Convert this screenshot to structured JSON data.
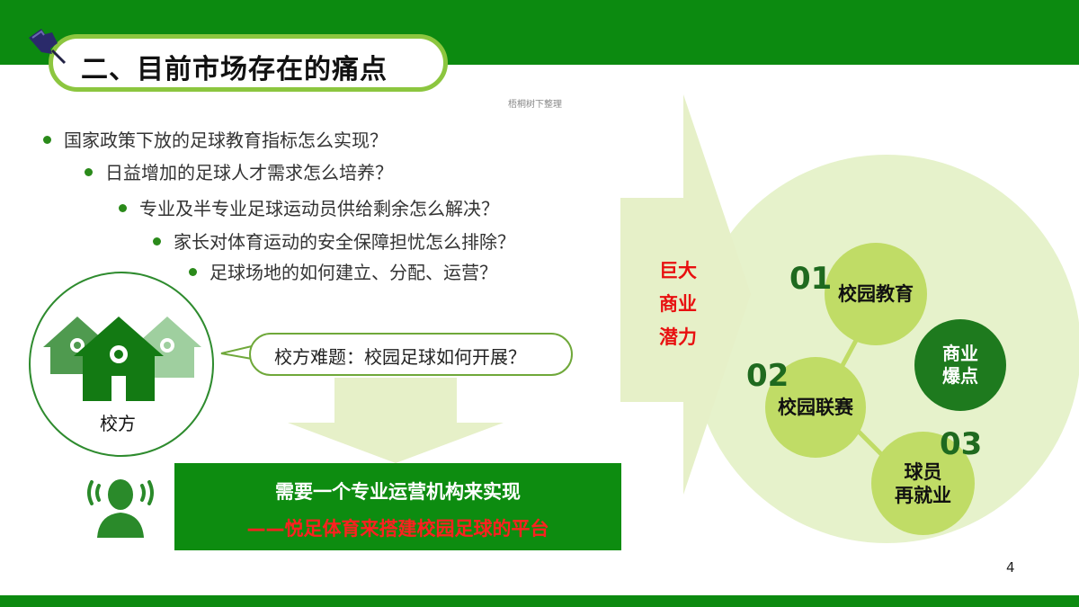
{
  "header": {
    "title": "二、目前市场存在的痛点",
    "watermark": "梧桐树下整理"
  },
  "bullets": [
    "国家政策下放的足球教育指标怎么实现？",
    "日益增加的足球人才需求怎么培养？",
    "专业及半专业足球运动员供给剩余怎么解决？",
    "家长对体育运动的安全保障担忧怎么排除？",
    "足球场地的如何建立、分配、运营？"
  ],
  "school": {
    "label": "校方",
    "speech": "校方难题：校园足球如何开展？"
  },
  "solution": {
    "line1": "需要一个专业运营机构来实现",
    "line2": "——悦足体育来搭建校园足球的平台"
  },
  "arrow": {
    "text": "巨大\n商业\n潜力"
  },
  "nodes": [
    {
      "num": "01",
      "label": "校园教育"
    },
    {
      "num": "02",
      "label": "校园联赛"
    },
    {
      "num": "03",
      "label": "球员\n再就业"
    }
  ],
  "center_node": {
    "label": "商业\n爆点"
  },
  "page_number": "4",
  "colors": {
    "brand_green": "#0c8a10",
    "light_green": "#8cc63f",
    "node_green": "#c0dc66",
    "dark_node": "#1e7a1e",
    "highlight_red": "#e81010"
  },
  "icons": [
    "pushpin-icon",
    "house-icon",
    "person-speaking-icon",
    "down-arrow-icon",
    "right-arrow-icon"
  ]
}
